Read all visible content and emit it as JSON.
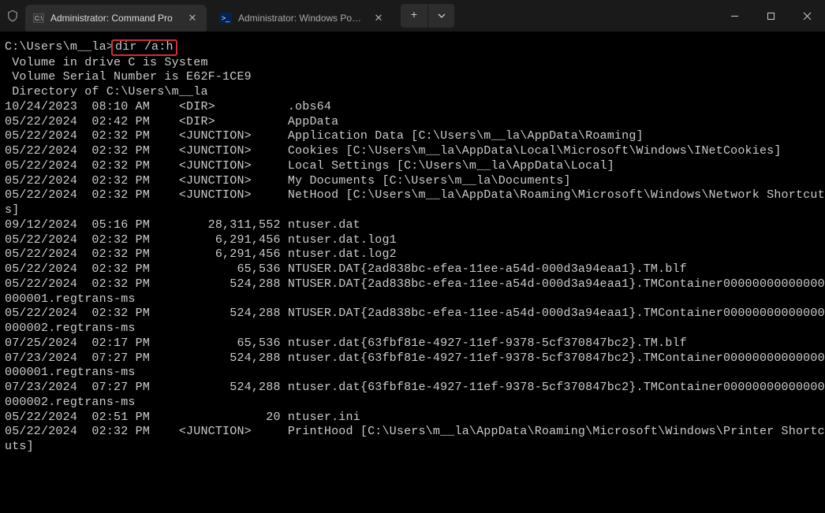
{
  "titlebar": {
    "tabs": [
      {
        "title": "Administrator: Command Pro",
        "icon": "cmd"
      },
      {
        "title": "Administrator: Windows Power",
        "icon": "ps"
      }
    ]
  },
  "terminal": {
    "prompt": "C:\\Users\\m__la>",
    "command": "dir /a:h",
    "header": [
      " Volume in drive C is System",
      " Volume Serial Number is E62F-1CE9",
      "",
      " Directory of C:\\Users\\m__la",
      ""
    ],
    "rows": [
      "10/24/2023  08:10 AM    <DIR>          .obs64",
      "05/22/2024  02:42 PM    <DIR>          AppData",
      "05/22/2024  02:32 PM    <JUNCTION>     Application Data [C:\\Users\\m__la\\AppData\\Roaming]",
      "05/22/2024  02:32 PM    <JUNCTION>     Cookies [C:\\Users\\m__la\\AppData\\Local\\Microsoft\\Windows\\INetCookies]",
      "05/22/2024  02:32 PM    <JUNCTION>     Local Settings [C:\\Users\\m__la\\AppData\\Local]",
      "05/22/2024  02:32 PM    <JUNCTION>     My Documents [C:\\Users\\m__la\\Documents]",
      "05/22/2024  02:32 PM    <JUNCTION>     NetHood [C:\\Users\\m__la\\AppData\\Roaming\\Microsoft\\Windows\\Network Shortcuts]",
      "09/12/2024  05:16 PM        28,311,552 ntuser.dat",
      "05/22/2024  02:32 PM         6,291,456 ntuser.dat.log1",
      "05/22/2024  02:32 PM         6,291,456 ntuser.dat.log2",
      "05/22/2024  02:32 PM            65,536 NTUSER.DAT{2ad838bc-efea-11ee-a54d-000d3a94eaa1}.TM.blf",
      "05/22/2024  02:32 PM           524,288 NTUSER.DAT{2ad838bc-efea-11ee-a54d-000d3a94eaa1}.TMContainer00000000000000000001.regtrans-ms",
      "05/22/2024  02:32 PM           524,288 NTUSER.DAT{2ad838bc-efea-11ee-a54d-000d3a94eaa1}.TMContainer00000000000000000002.regtrans-ms",
      "07/25/2024  02:17 PM            65,536 ntuser.dat{63fbf81e-4927-11ef-9378-5cf370847bc2}.TM.blf",
      "07/23/2024  07:27 PM           524,288 ntuser.dat{63fbf81e-4927-11ef-9378-5cf370847bc2}.TMContainer00000000000000000001.regtrans-ms",
      "07/23/2024  07:27 PM           524,288 ntuser.dat{63fbf81e-4927-11ef-9378-5cf370847bc2}.TMContainer00000000000000000002.regtrans-ms",
      "05/22/2024  02:51 PM                20 ntuser.ini",
      "05/22/2024  02:32 PM    <JUNCTION>     PrintHood [C:\\Users\\m__la\\AppData\\Roaming\\Microsoft\\Windows\\Printer Shortcuts]"
    ]
  }
}
